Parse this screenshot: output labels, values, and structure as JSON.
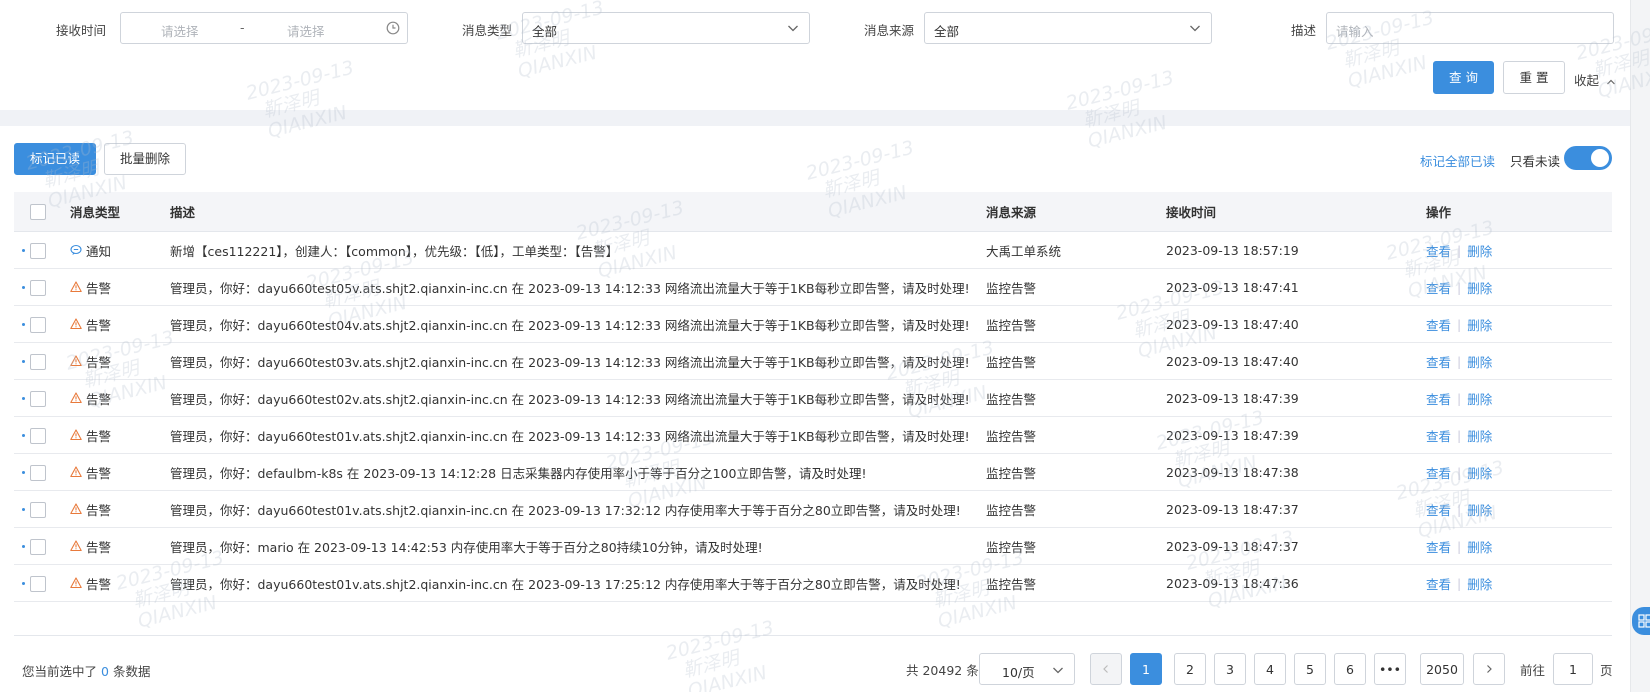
{
  "colors": {
    "accent": "#3b8ede",
    "warning": "#e87a3c",
    "border": "#cfd4db"
  },
  "filters": {
    "receive_time": {
      "label": "接收时间",
      "start_placeholder": "请选择",
      "separator": "-",
      "end_placeholder": "请选择",
      "icon": "clock-icon"
    },
    "message_type": {
      "label": "消息类型",
      "value": "全部"
    },
    "message_source": {
      "label": "消息来源",
      "value": "全部"
    },
    "description": {
      "label": "描述",
      "placeholder": "请输入"
    },
    "query_label": "查 询",
    "reset_label": "重 置",
    "collapse_label": "收起"
  },
  "toolbar": {
    "mark_read_label": "标记已读",
    "batch_delete_label": "批量删除",
    "mark_all_read_label": "标记全部已读",
    "only_unread_label": "只看未读",
    "only_unread_on": true
  },
  "table": {
    "columns": {
      "type": "消息类型",
      "desc": "描述",
      "source": "消息来源",
      "time": "接收时间",
      "actions": "操作"
    },
    "view_label": "查看",
    "delete_label": "删除",
    "rows": [
      {
        "type": "通知",
        "icon": "chat-icon",
        "desc": "新增【ces112221】，创建人：【common】，优先级：【低】，工单类型：【告警】",
        "source": "大禹工单系统",
        "time": "2023-09-13 18:57:19"
      },
      {
        "type": "告警",
        "icon": "warning-icon",
        "desc": "管理员，你好：dayu660test05v.ats.shjt2.qianxin-inc.cn 在 2023-09-13 14:12:33 网络流出流量大于等于1KB每秒立即告警，请及时处理!",
        "source": "监控告警",
        "time": "2023-09-13 18:47:41"
      },
      {
        "type": "告警",
        "icon": "warning-icon",
        "desc": "管理员，你好：dayu660test04v.ats.shjt2.qianxin-inc.cn 在 2023-09-13 14:12:33 网络流出流量大于等于1KB每秒立即告警，请及时处理!",
        "source": "监控告警",
        "time": "2023-09-13 18:47:40"
      },
      {
        "type": "告警",
        "icon": "warning-icon",
        "desc": "管理员，你好：dayu660test03v.ats.shjt2.qianxin-inc.cn 在 2023-09-13 14:12:33 网络流出流量大于等于1KB每秒立即告警，请及时处理!",
        "source": "监控告警",
        "time": "2023-09-13 18:47:40"
      },
      {
        "type": "告警",
        "icon": "warning-icon",
        "desc": "管理员，你好：dayu660test02v.ats.shjt2.qianxin-inc.cn 在 2023-09-13 14:12:33 网络流出流量大于等于1KB每秒立即告警，请及时处理!",
        "source": "监控告警",
        "time": "2023-09-13 18:47:39"
      },
      {
        "type": "告警",
        "icon": "warning-icon",
        "desc": "管理员，你好：dayu660test01v.ats.shjt2.qianxin-inc.cn 在 2023-09-13 14:12:33 网络流出流量大于等于1KB每秒立即告警，请及时处理!",
        "source": "监控告警",
        "time": "2023-09-13 18:47:39"
      },
      {
        "type": "告警",
        "icon": "warning-icon",
        "desc": "管理员，你好：defaulbm-k8s 在 2023-09-13 14:12:28 日志采集器内存使用率小于等于百分之100立即告警，请及时处理!",
        "source": "监控告警",
        "time": "2023-09-13 18:47:38"
      },
      {
        "type": "告警",
        "icon": "warning-icon",
        "desc": "管理员，你好：dayu660test01v.ats.shjt2.qianxin-inc.cn 在 2023-09-13 17:32:12 内存使用率大于等于百分之80立即告警，请及时处理!",
        "source": "监控告警",
        "time": "2023-09-13 18:47:37"
      },
      {
        "type": "告警",
        "icon": "warning-icon",
        "desc": "管理员，你好：mario 在 2023-09-13 14:42:53 内存使用率大于等于百分之80持续10分钟，请及时处理!",
        "source": "监控告警",
        "time": "2023-09-13 18:47:37"
      },
      {
        "type": "告警",
        "icon": "warning-icon",
        "desc": "管理员，你好：dayu660test01v.ats.shjt2.qianxin-inc.cn 在 2023-09-13 17:25:12 内存使用率大于等于百分之80立即告警，请及时处理!",
        "source": "监控告警",
        "time": "2023-09-13 18:47:36"
      }
    ]
  },
  "footer": {
    "selected_prefix": "您当前选中了",
    "selected_count": "0",
    "selected_suffix": "条数据",
    "total_text": "共 20492 条",
    "page_size": "10/页",
    "pages": [
      "1",
      "2",
      "3",
      "4",
      "5",
      "6",
      "•••",
      "2050"
    ],
    "current_page": "1",
    "goto_label": "前往",
    "goto_value": "1",
    "page_suffix": "页"
  },
  "watermark": {
    "date": "2023-09-13",
    "name": "靳泽明",
    "org": "QIANXIN"
  }
}
